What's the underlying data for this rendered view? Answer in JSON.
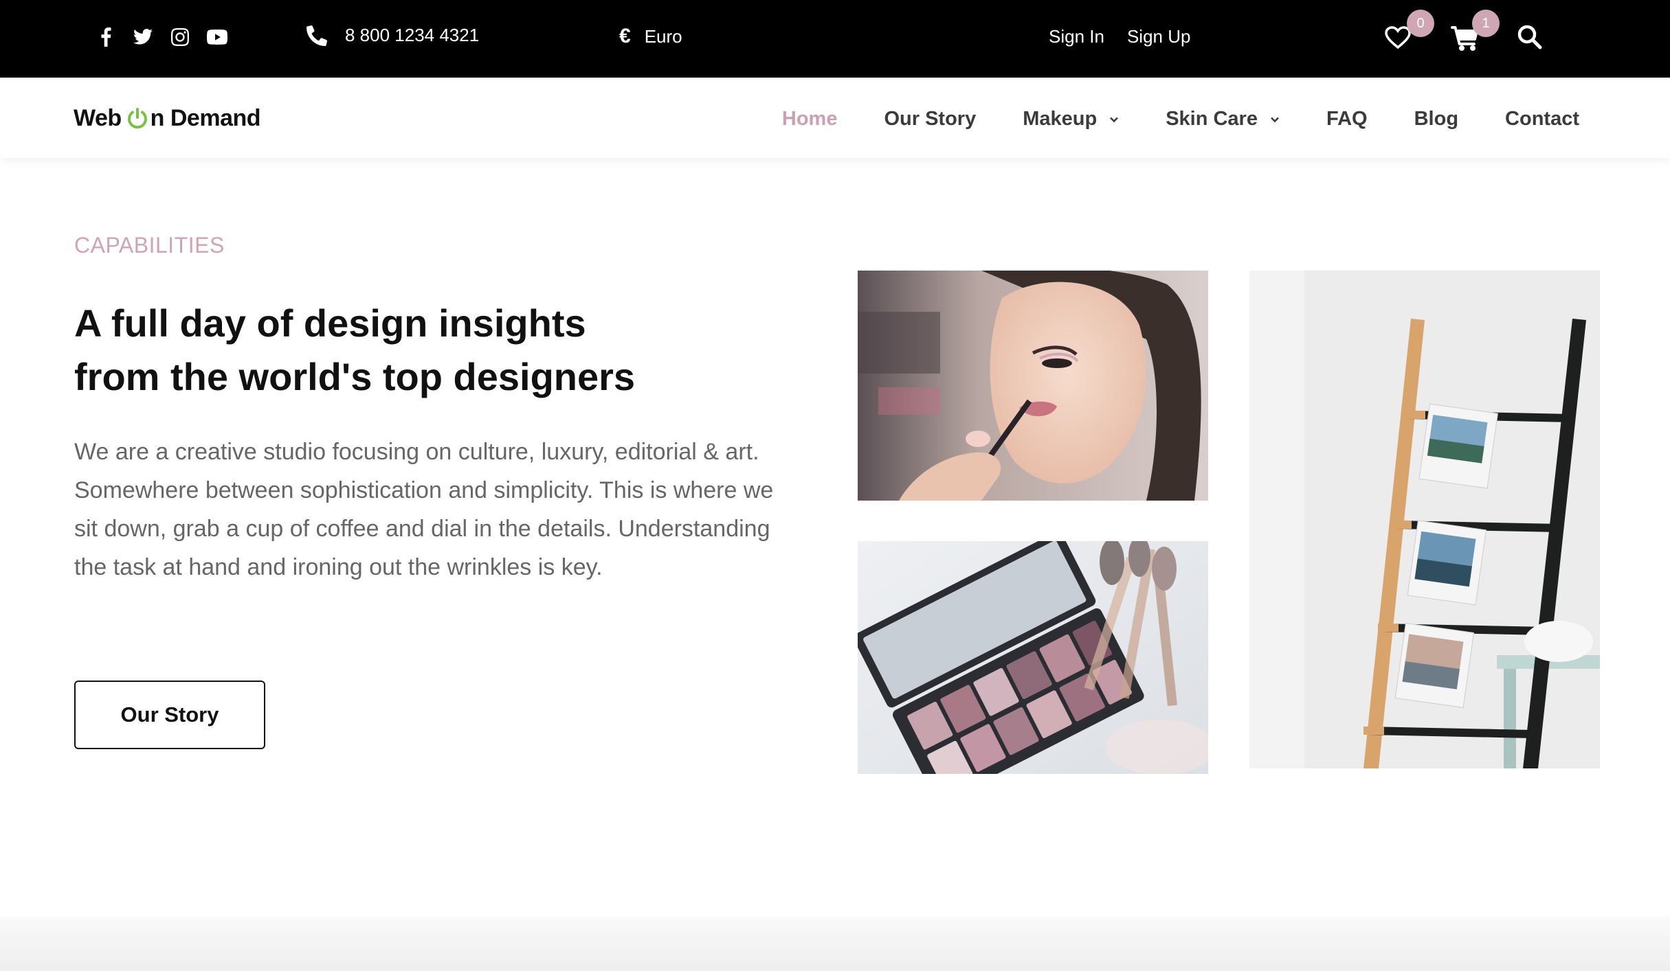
{
  "topbar": {
    "social_icons": [
      "facebook-icon",
      "twitter-icon",
      "instagram-icon",
      "youtube-icon"
    ],
    "phone": "8 800 1234 4321",
    "currency_symbol": "€",
    "currency_label": "Euro",
    "sign_in": "Sign In",
    "sign_up": "Sign Up",
    "wishlist_count": "0",
    "cart_count": "1"
  },
  "header": {
    "logo_part1": "Web",
    "logo_part2": "n Demand",
    "nav": [
      {
        "label": "Home",
        "active": true
      },
      {
        "label": "Our Story"
      },
      {
        "label": "Makeup",
        "dropdown": true
      },
      {
        "label": "Skin Care",
        "dropdown": true
      },
      {
        "label": "FAQ"
      },
      {
        "label": "Blog"
      },
      {
        "label": "Contact"
      }
    ]
  },
  "main": {
    "eyebrow": "CAPABILITIES",
    "heading_line1": "A full day of design insights",
    "heading_line2": "from the world's top designers",
    "body": "We are a creative studio focusing on culture, luxury, editorial & art. Somewhere between sophistication and simplicity. This is where we sit down, grab a cup of coffee and dial in the details. Understanding the task at hand and ironing out the wrinkles is key.",
    "button_label": "Our Story"
  },
  "colors": {
    "accent": "#d0a3b5",
    "topbar_bg": "#000000",
    "logo_green": "#7ac143"
  }
}
